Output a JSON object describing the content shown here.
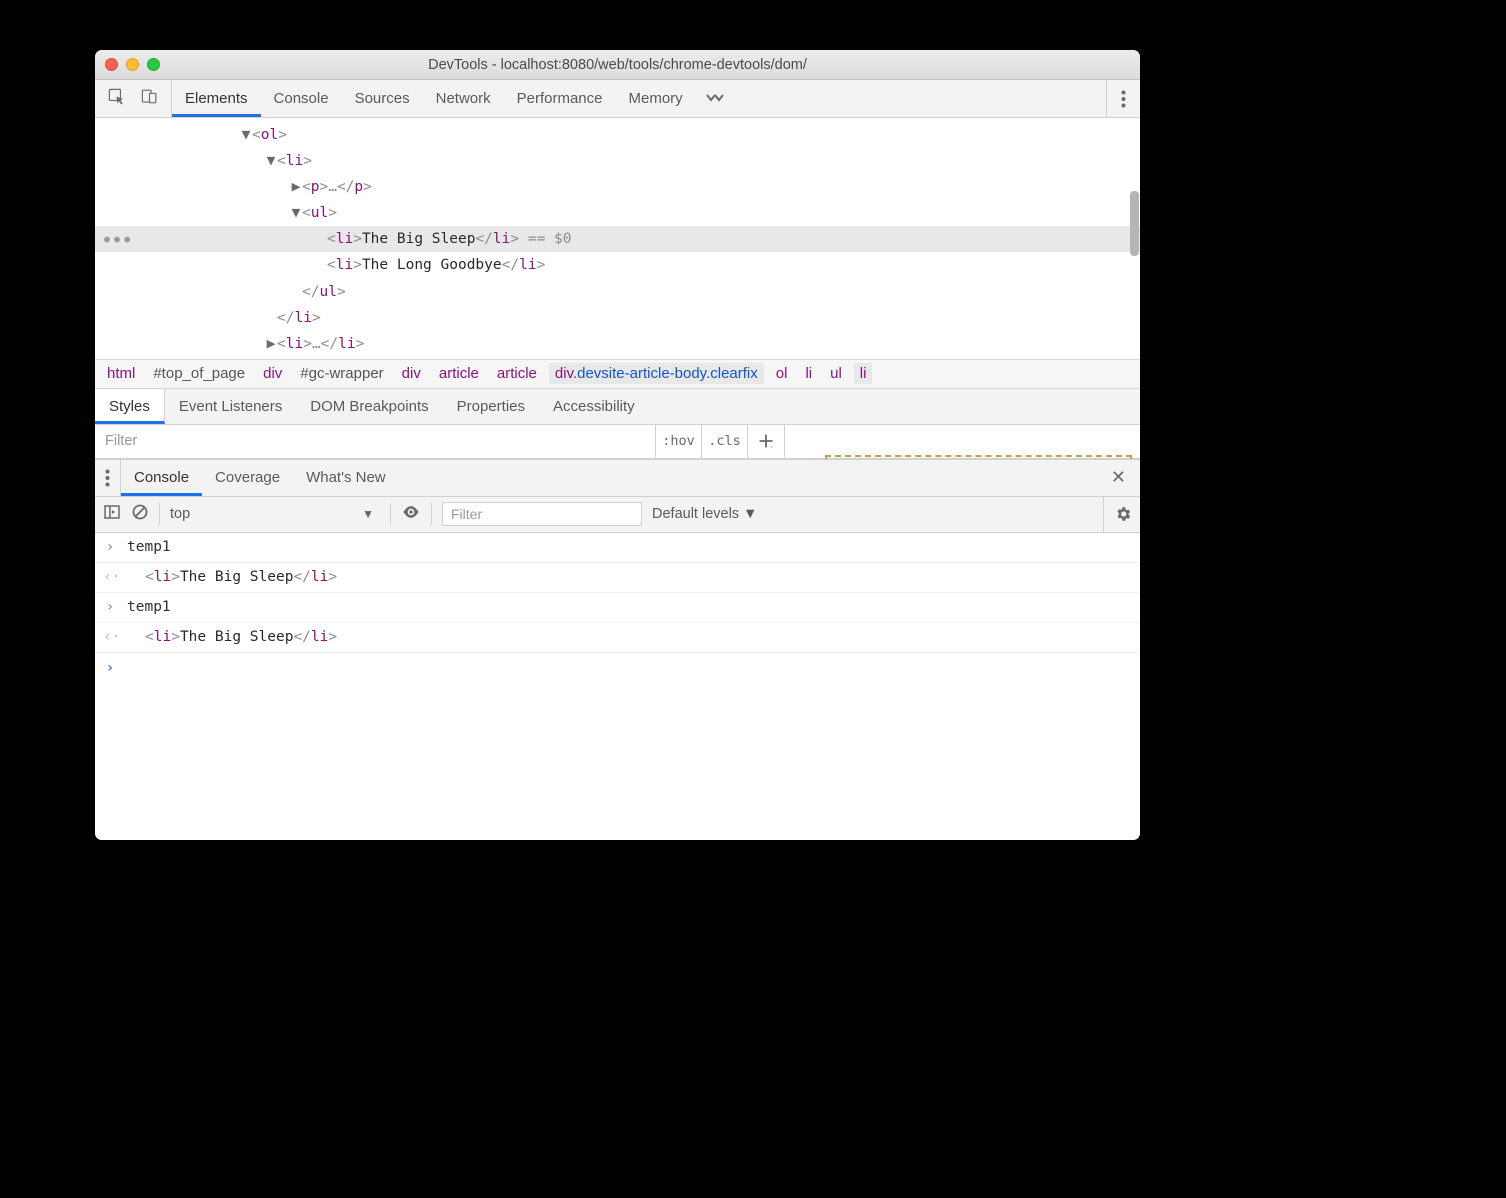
{
  "window": {
    "title": "DevTools - localhost:8080/web/tools/chrome-devtools/dom/"
  },
  "tabs": {
    "items": [
      "Elements",
      "Console",
      "Sources",
      "Network",
      "Performance",
      "Memory"
    ],
    "active_index": 0
  },
  "dom_tree": {
    "lines": [
      {
        "indent": 145,
        "tri": "▼",
        "open": "ol"
      },
      {
        "indent": 170,
        "tri": "▼",
        "open": "li"
      },
      {
        "indent": 195,
        "tri": "▶",
        "open": "p",
        "ellip": true,
        "close": "p"
      },
      {
        "indent": 195,
        "tri": "▼",
        "open": "ul"
      },
      {
        "indent": 232,
        "open": "li",
        "text": "The Big Sleep",
        "close": "li",
        "selected": true,
        "anno": " == $0"
      },
      {
        "indent": 232,
        "open": "li",
        "text": "The Long Goodbye",
        "close": "li"
      },
      {
        "indent": 207,
        "closeonly": "ul"
      },
      {
        "indent": 182,
        "closeonly": "li"
      },
      {
        "indent": 170,
        "tri": "▶",
        "open": "li",
        "ellip": true,
        "close": "li"
      }
    ]
  },
  "breadcrumb": [
    {
      "tag": "html"
    },
    {
      "sel": "#top_of_page",
      "dark": true
    },
    {
      "tag": "div"
    },
    {
      "sel": "#gc-wrapper",
      "dark": true
    },
    {
      "tag": "div"
    },
    {
      "tag": "article"
    },
    {
      "tag": "article"
    },
    {
      "tag": "div",
      "sel": ".devsite-article-body.clearfix",
      "hi": true
    },
    {
      "tag": "ol"
    },
    {
      "tag": "li"
    },
    {
      "tag": "ul"
    },
    {
      "tag": "li",
      "hi": true
    }
  ],
  "subtabs": {
    "items": [
      "Styles",
      "Event Listeners",
      "DOM Breakpoints",
      "Properties",
      "Accessibility"
    ],
    "active_index": 0
  },
  "filter": {
    "placeholder": "Filter",
    "hov": ":hov",
    "cls": ".cls"
  },
  "drawer_tabs": {
    "items": [
      "Console",
      "Coverage",
      "What's New"
    ],
    "active_index": 0
  },
  "console_toolbar": {
    "context": "top",
    "filter_placeholder": "Filter",
    "levels": "Default levels"
  },
  "console": {
    "rows": [
      {
        "dir": "in",
        "text": "temp1"
      },
      {
        "dir": "out",
        "html_open": "li",
        "html_text": "The Big Sleep",
        "html_close": "li"
      },
      {
        "dir": "in",
        "text": "temp1"
      },
      {
        "dir": "out",
        "html_open": "li",
        "html_text": "The Big Sleep",
        "html_close": "li"
      }
    ]
  }
}
